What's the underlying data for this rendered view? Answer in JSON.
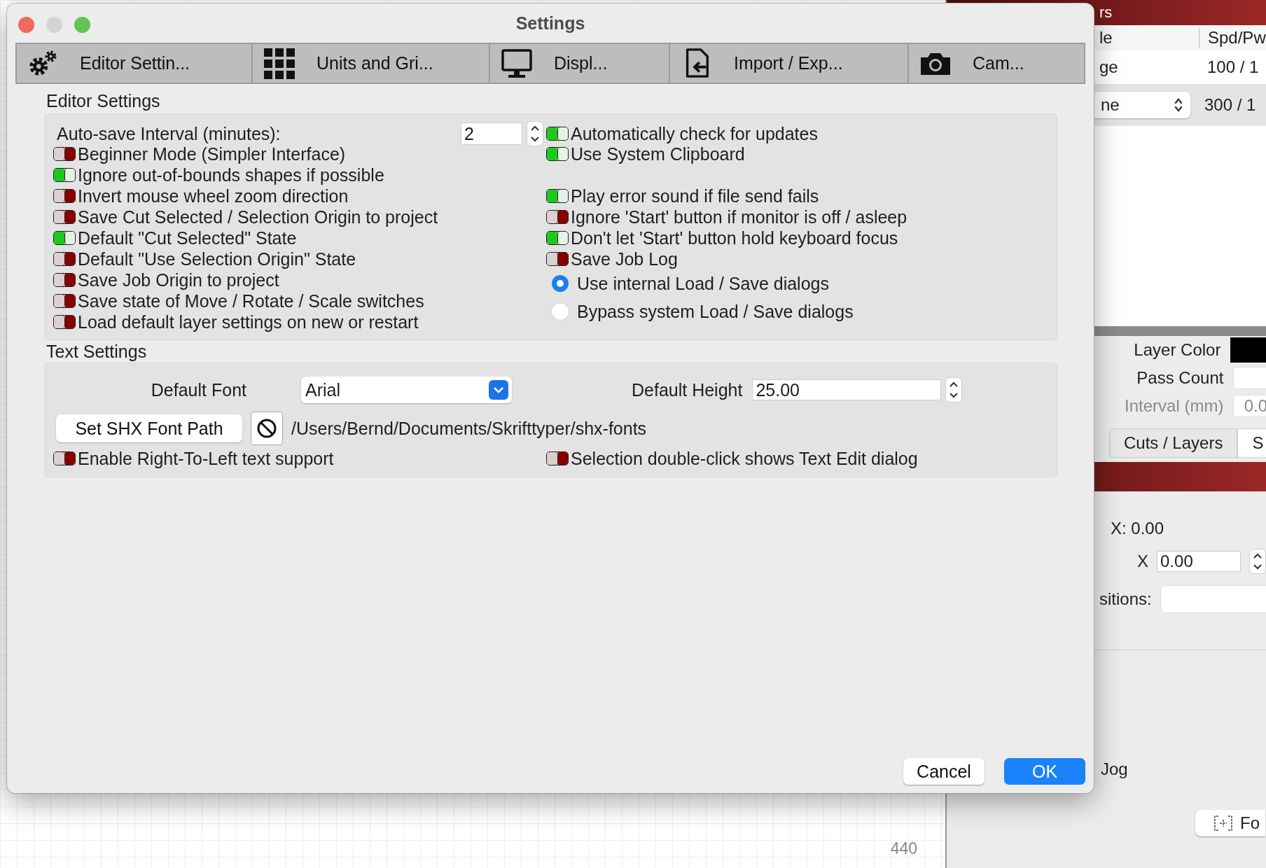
{
  "window": {
    "title": "Settings"
  },
  "tabs": [
    {
      "label": "Editor Settin..."
    },
    {
      "label": "Units and Gri..."
    },
    {
      "label": "Displ..."
    },
    {
      "label": "Import / Exp..."
    },
    {
      "label": "Cam..."
    }
  ],
  "editor_settings": {
    "title": "Editor Settings",
    "autosave": {
      "label": "Auto-save Interval (minutes):",
      "value": "2"
    },
    "left_toggles": [
      {
        "label": "Beginner Mode (Simpler Interface)",
        "on": false
      },
      {
        "label": "Ignore out-of-bounds shapes if possible",
        "on": true
      },
      {
        "label": "Invert mouse wheel zoom direction",
        "on": false
      },
      {
        "label": "Save Cut Selected / Selection Origin to project",
        "on": false
      },
      {
        "label": "Default \"Cut Selected\" State",
        "on": true
      },
      {
        "label": "Default \"Use Selection Origin\" State",
        "on": false
      },
      {
        "label": "Save Job Origin to project",
        "on": false
      },
      {
        "label": "Save state of Move / Rotate / Scale switches",
        "on": false
      },
      {
        "label": "Load default layer settings on new or restart",
        "on": false
      }
    ],
    "right_toggles": [
      {
        "label": "Automatically check for updates",
        "on": true
      },
      {
        "label": "Use System Clipboard",
        "on": true
      },
      {
        "label": "Play error sound if file send fails",
        "on": true
      },
      {
        "label": "Ignore 'Start' button if monitor is off / asleep",
        "on": false
      },
      {
        "label": "Don't let 'Start' button hold keyboard focus",
        "on": true
      },
      {
        "label": "Save Job Log",
        "on": false
      }
    ],
    "dialog_mode": [
      {
        "label": "Use internal Load / Save dialogs",
        "selected": true
      },
      {
        "label": "Bypass system Load / Save dialogs",
        "selected": false
      }
    ]
  },
  "text_settings": {
    "title": "Text Settings",
    "default_font": {
      "label": "Default Font",
      "value": "Arial"
    },
    "default_height": {
      "label": "Default Height",
      "value": "25.00"
    },
    "shx_button": "Set SHX Font Path",
    "shx_path": "/Users/Bernd/Documents/Skrifttyper/shx-fonts",
    "toggles": [
      {
        "label": "Enable Right-To-Left text support",
        "on": false
      },
      {
        "label": "Selection double-click shows Text Edit dialog",
        "on": false
      }
    ]
  },
  "buttons": [
    {
      "label": "Cancel",
      "kind": "secondary"
    },
    {
      "label": "OK",
      "kind": "primary"
    }
  ],
  "background": {
    "canvas_label": "440",
    "panel_title": "rs",
    "columns": [
      "le",
      "Spd/Pw"
    ],
    "rows": [
      {
        "kind": "text",
        "name": "ge",
        "speed": "100 / 1"
      },
      {
        "kind": "select",
        "name": "ne",
        "speed": "300 / 1"
      }
    ],
    "layer_color": "Layer Color",
    "pass_count": "Pass Count",
    "interval": {
      "label": "Interval (mm)",
      "value": "0.0",
      "disabled": true
    },
    "panel_tabs": [
      {
        "label": "Cuts / Layers",
        "selected": false
      },
      {
        "label": "S",
        "selected": true
      }
    ],
    "x_readout": "X: 0.00",
    "x_label": "X",
    "x_value": "0.00",
    "positions_label": "sitions:",
    "jog_label": "Jog",
    "focus_button": "Fo"
  }
}
